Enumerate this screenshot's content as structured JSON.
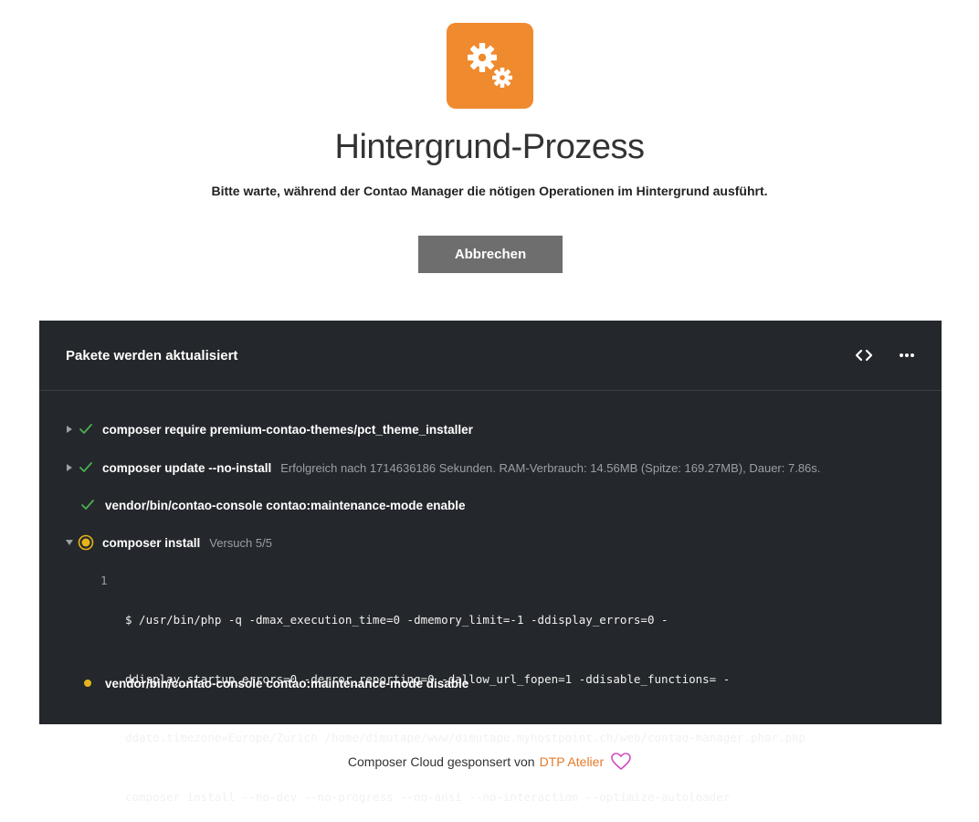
{
  "header": {
    "title": "Hintergrund-Prozess",
    "subtitle": "Bitte warte, während der Contao Manager die nötigen Operationen im Hintergrund ausführt.",
    "logo_icon": "gears-icon",
    "brand_color": "#f08a2e"
  },
  "cancel_label": "Abbrechen",
  "console": {
    "title": "Pakete werden aktualisiert",
    "operations": [
      {
        "status": "success",
        "expandable": true,
        "expanded": false,
        "command": "composer require premium-contao-themes/pct_theme_installer",
        "detail": ""
      },
      {
        "status": "success",
        "expandable": true,
        "expanded": false,
        "command": "composer update --no-install",
        "detail": "Erfolgreich nach 1714636186 Sekunden. RAM-Verbrauch: 14.56MB (Spitze: 169.27MB), Dauer: 7.86s."
      },
      {
        "status": "success",
        "expandable": false,
        "expanded": false,
        "command": "vendor/bin/contao-console contao:maintenance-mode enable",
        "detail": ""
      },
      {
        "status": "running",
        "expandable": true,
        "expanded": true,
        "command": "composer install",
        "detail": "Versuch 5/5"
      },
      {
        "status": "pending",
        "expandable": false,
        "expanded": false,
        "command": "vendor/bin/contao-console contao:maintenance-mode disable",
        "detail": ""
      }
    ],
    "log": {
      "line_number": "1",
      "lines": [
        "$ /usr/bin/php -q -dmax_execution_time=0 -dmemory_limit=-1 -ddisplay_errors=0 -",
        "ddisplay_startup_errors=0 -derror_reporting=0 -dallow_url_fopen=1 -ddisable_functions= -",
        "ddate.timezone=Europe/Zurich /home/dimutape/www/dimutape.myhostpoint.ch/web/contao-manager.phar.php",
        "composer install --no-dev --no-progress --no-ansi --no-interaction --optimize-autoloader"
      ]
    }
  },
  "footer": {
    "text": "Composer Cloud gesponsert von",
    "link_label": "DTP Atelier",
    "icon": "heart-icon"
  },
  "colors": {
    "success": "#4caf50",
    "running": "#e6b41a",
    "link": "#e8782a",
    "heart": "#d04cc2"
  }
}
